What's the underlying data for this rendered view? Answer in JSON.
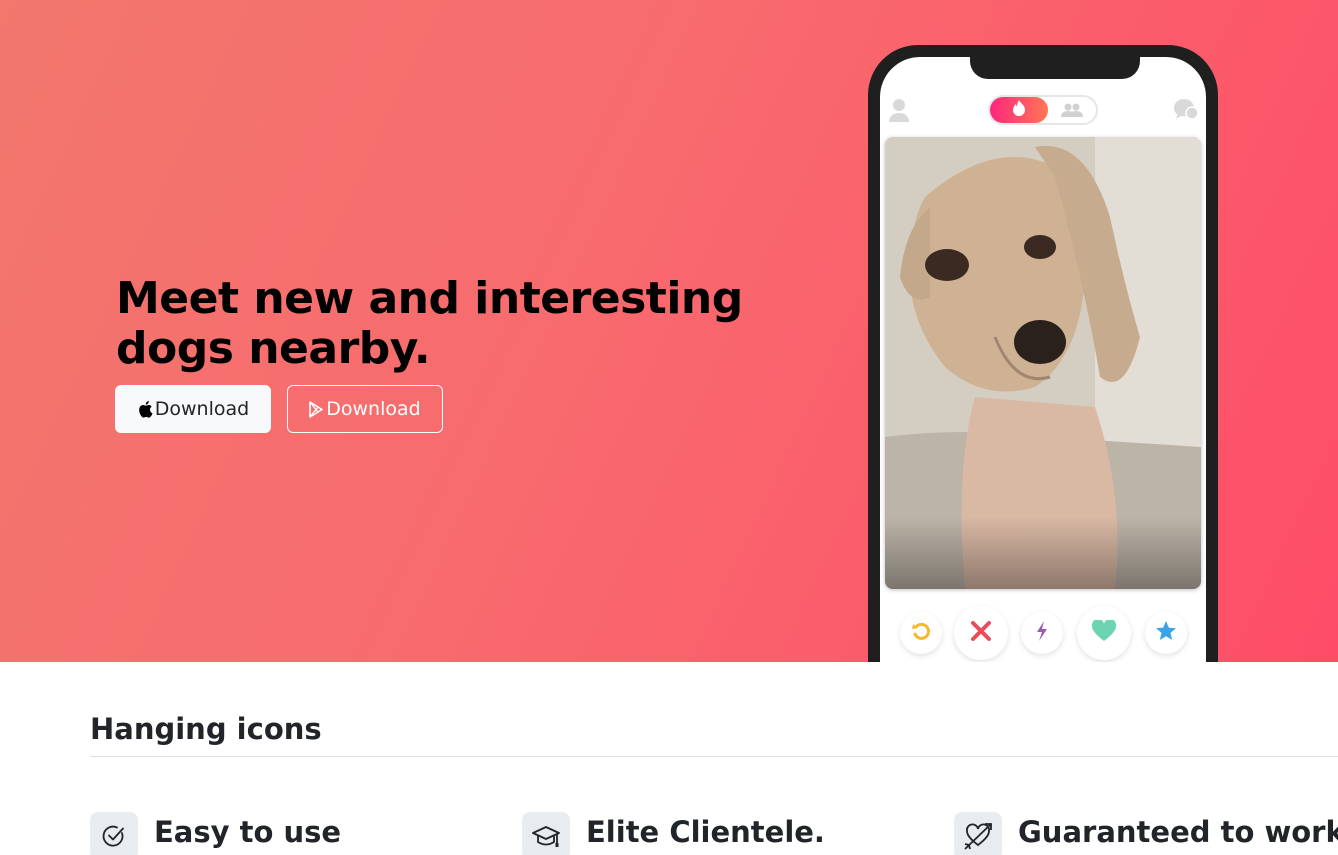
{
  "hero": {
    "headline": "Meet new and interesting dogs nearby.",
    "buttons": [
      {
        "label": "Download",
        "icon": "apple-icon"
      },
      {
        "label": "Download",
        "icon": "google-play-icon"
      }
    ],
    "gradient_colors": [
      "#f2776d",
      "#fe4c68"
    ]
  },
  "phone": {
    "top_icons": [
      "profile-icon",
      "flame-icon",
      "group-icon",
      "chat-icon"
    ],
    "photo": "dog-photo",
    "actions": [
      "rewind-icon",
      "nope-icon",
      "boost-icon",
      "like-icon",
      "super-like-icon"
    ],
    "action_colors": [
      "#f5b82e",
      "#ea4c5a",
      "#9b59b6",
      "#6cd4b0",
      "#3ca4e6"
    ]
  },
  "features_section": {
    "title": "Hanging icons",
    "items": [
      {
        "title": "Easy to use",
        "icon": "check-circle-icon"
      },
      {
        "title": "Elite Clientele.",
        "icon": "mortarboard-icon"
      },
      {
        "title": "Guaranteed to work.",
        "icon": "heart-arrow-icon"
      }
    ]
  }
}
